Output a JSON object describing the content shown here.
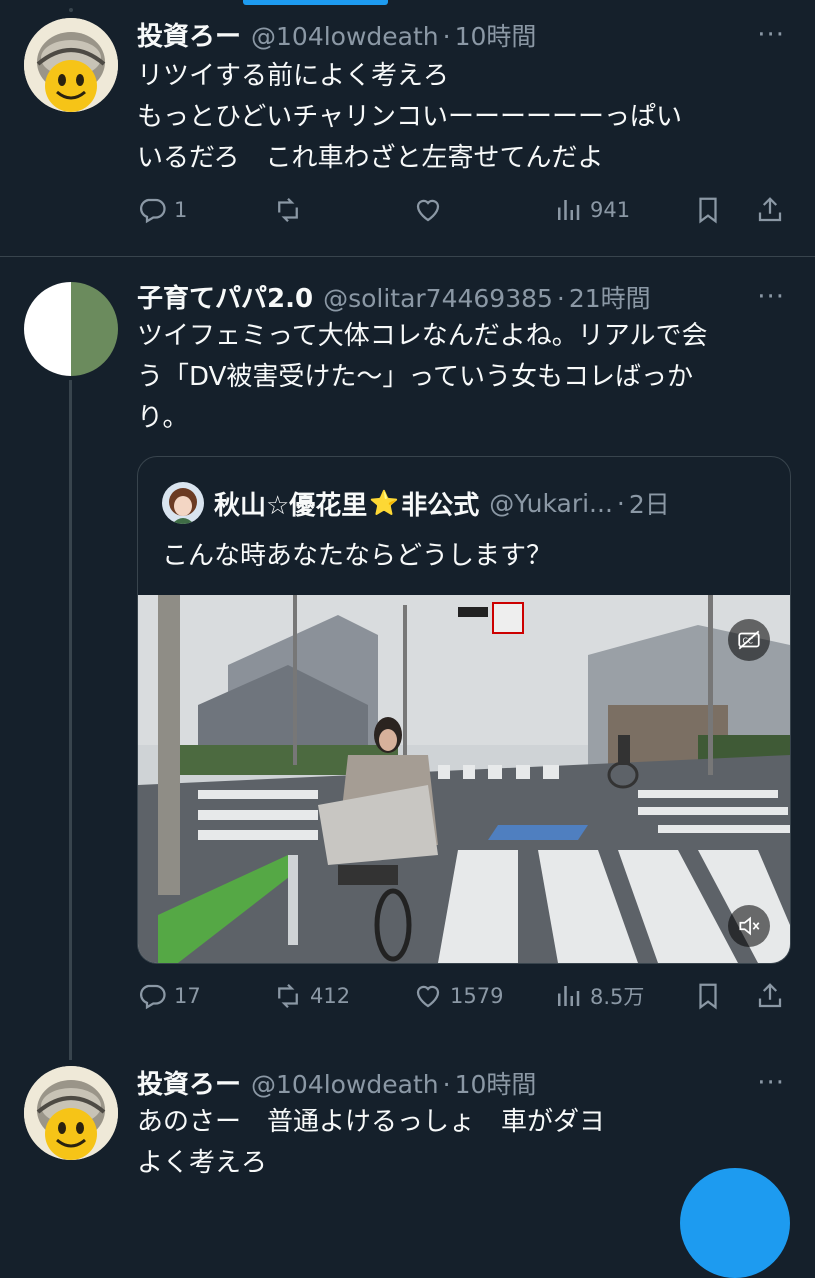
{
  "tweets": [
    {
      "name": "投資ろー",
      "handle": "@104lowdeath",
      "time": "10時間",
      "lines": [
        "リツイする前によく考えろ",
        "もっとひどいチャリンコいーーーーーーっぱい",
        "いるだろ　これ車わざと左寄せてんだよ"
      ],
      "replies": "1",
      "retweets": "",
      "likes": "",
      "views": "941"
    },
    {
      "name": "子育てパパ2.0",
      "handle": "@solitar74469385",
      "time": "21時間",
      "lines": [
        "ツイフェミって大体コレなんだよね。リアルで会",
        "う「DV被害受けた〜」っていう女もコレばっか",
        "り。"
      ],
      "replies": "17",
      "retweets": "412",
      "likes": "1579",
      "views": "8.5万",
      "quote": {
        "name": "秋山☆優花里",
        "name_suffix": "非公式",
        "star_emoji": "⭐",
        "handle": "@Yukari...",
        "time": "2日",
        "text": "こんな時あなたならどうします？"
      }
    },
    {
      "name": "投資ろー",
      "handle": "@104lowdeath",
      "time": "10時間",
      "lines": [
        "あのさー　普通よけるっしょ　車がダヨ",
        "よく考えろ"
      ]
    }
  ],
  "ui": {
    "separator": "·",
    "more": "···"
  },
  "icons": {
    "reply": "reply-icon",
    "retweet": "retweet-icon",
    "like": "heart-icon",
    "views": "views-icon",
    "bookmark": "bookmark-icon",
    "share": "share-icon",
    "captions": "captions-icon",
    "mute": "mute-icon"
  },
  "colors": {
    "background": "#15202b",
    "text": "#f7f9f9",
    "muted": "#8b98a5",
    "border": "#38444d",
    "accent": "#1d9bf0"
  }
}
